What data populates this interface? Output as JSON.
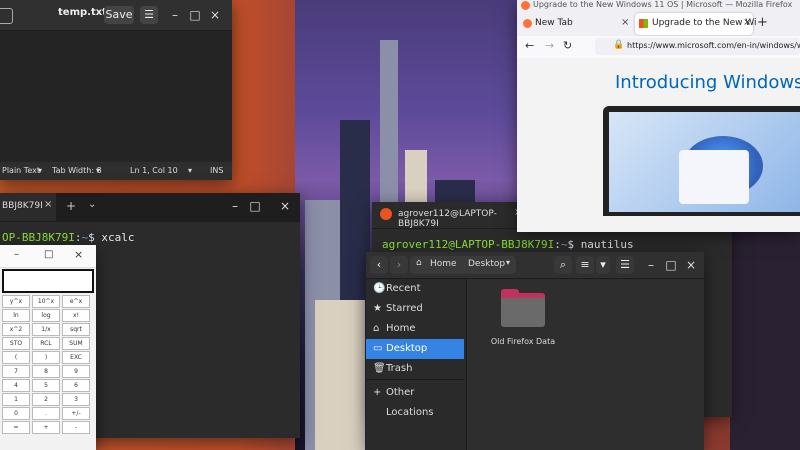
{
  "editor": {
    "title": "temp.txt",
    "save_label": "Save",
    "menu_icon": "hamburger-icon",
    "status": {
      "language": "Plain Text",
      "tab_width": "Tab Width: 8",
      "position": "Ln 1, Col 10",
      "mode": "INS"
    }
  },
  "terminal_left": {
    "tab_title": "BBJ8K79I",
    "prompt_host": "OP-BBJ8K79I",
    "prompt_sep": ":",
    "prompt_path": "~",
    "prompt_symbol": "$",
    "command": "xcalc"
  },
  "xcalc": {
    "keys": [
      "y^x",
      "10^x",
      "e^x",
      "ln",
      "log",
      "x!",
      "x^2",
      "1/x",
      "sqrt",
      "STO",
      "RCL",
      "SUM",
      "(",
      ")",
      "EXC",
      "7",
      "8",
      "9",
      "4",
      "5",
      "6",
      "1",
      "2",
      "3",
      "0",
      ".",
      "+/-",
      "=",
      "+",
      "-"
    ]
  },
  "terminal_right": {
    "tab_title": "agrover112@LAPTOP-BBJ8K79I",
    "prompt_host": "agrover112@LAPTOP-BBJ8K79I",
    "prompt_sep": ":",
    "prompt_path": "~",
    "prompt_symbol": "$",
    "command": "nautilus"
  },
  "firefox": {
    "title": "Upgrade to the New Windows 11 OS | Microsoft — Mozilla Firefox",
    "tabs": [
      {
        "label": "New Tab"
      },
      {
        "label": "Upgrade to the New Wi"
      }
    ],
    "url": "https://www.microsoft.com/en-in/windows/windo",
    "heading": "Introducing Windows"
  },
  "nautilus": {
    "path": [
      "Home",
      "Desktop"
    ],
    "sidebar": [
      {
        "label": "Recent"
      },
      {
        "label": "Starred"
      },
      {
        "label": "Home"
      },
      {
        "label": "Desktop"
      },
      {
        "label": "Trash"
      },
      {
        "label": "Other Locations"
      }
    ],
    "active_index": 3,
    "folder": {
      "label": "Old Firefox Data",
      "color": "#c0315e"
    }
  }
}
